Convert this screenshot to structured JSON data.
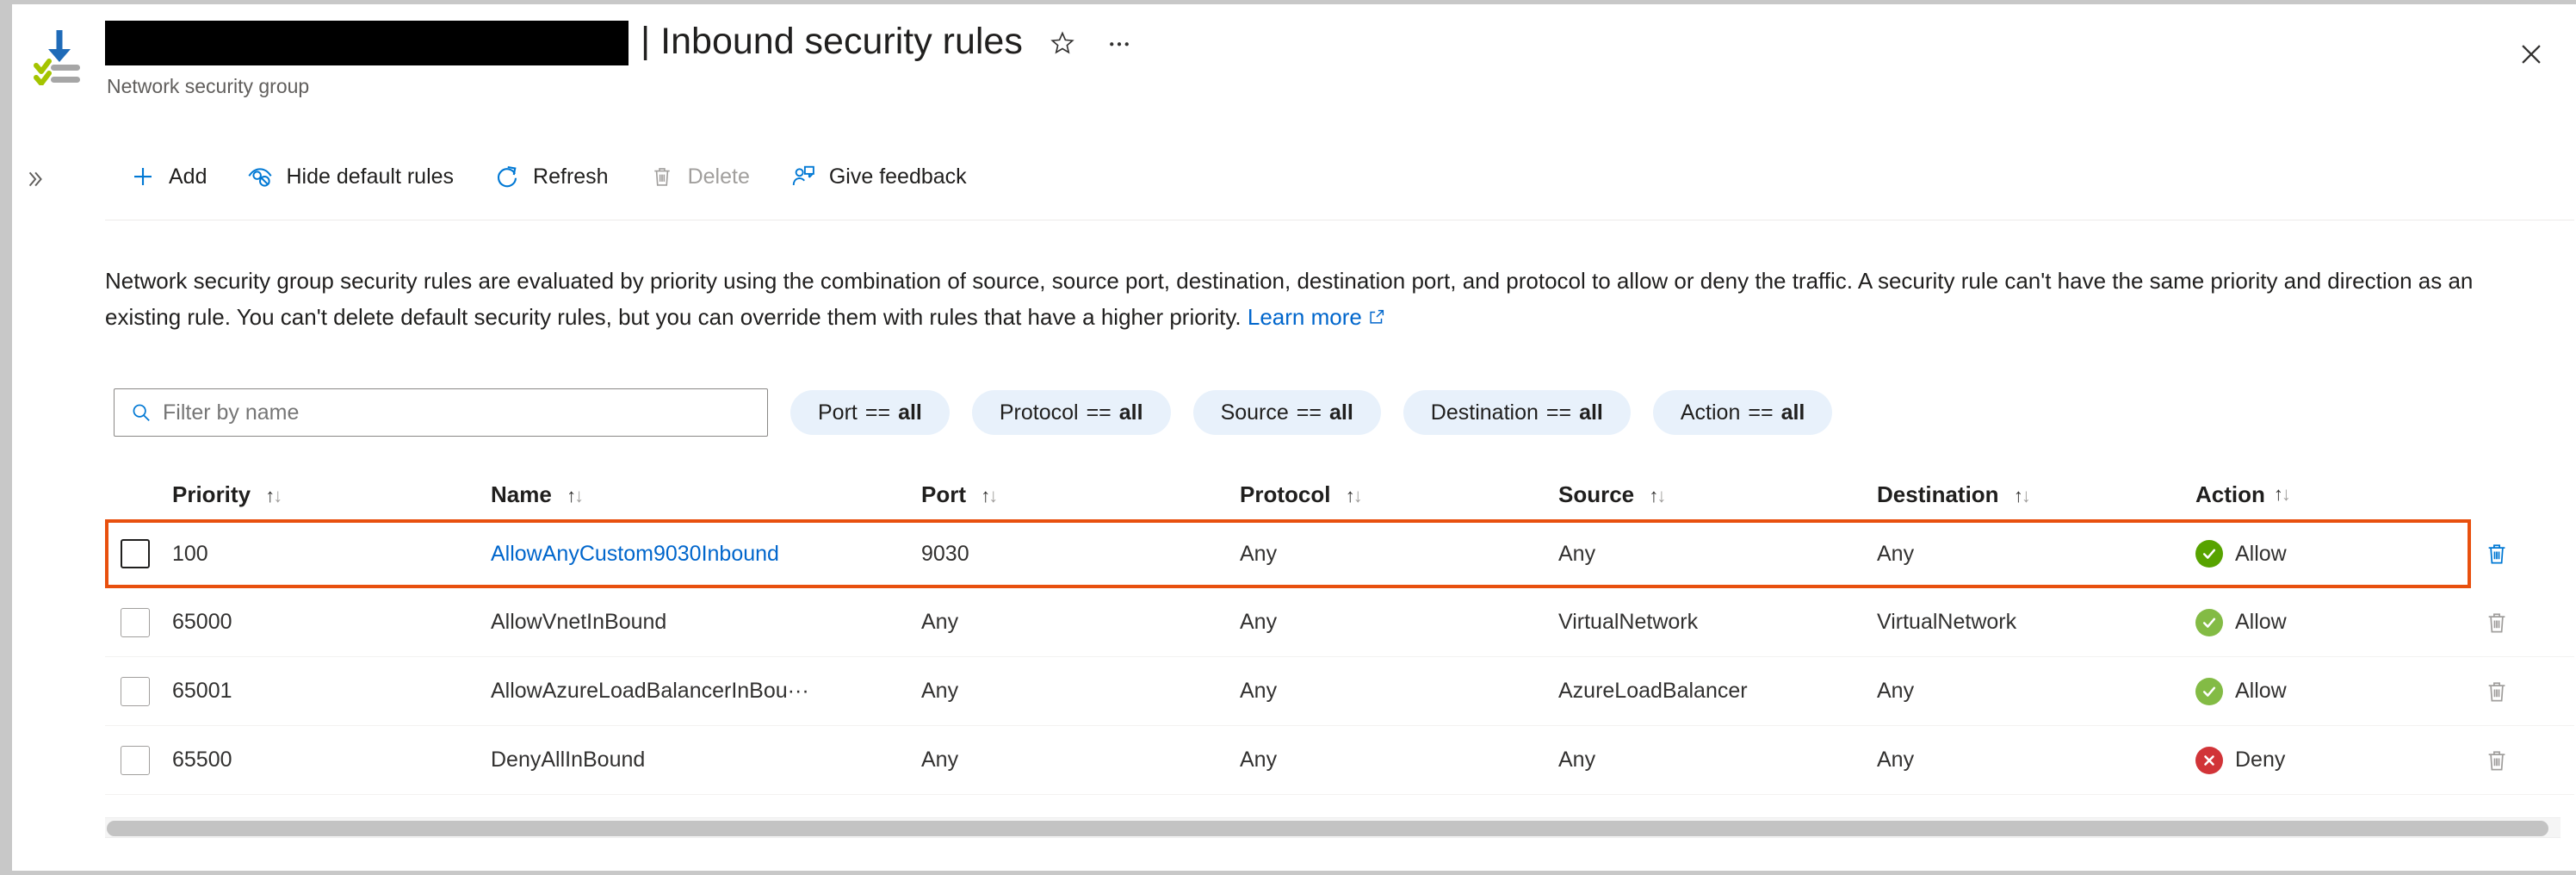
{
  "window": {
    "close_label": "×"
  },
  "header": {
    "resource_name_redacted": "",
    "separator": "|",
    "title": "Inbound security rules",
    "subtitle": "Network security group",
    "favorite_icon": "star-icon",
    "more_icon": "ellipsis-icon",
    "resource_icon": "network-security-group-icon"
  },
  "toolbar": {
    "expand_icon": "double-chevron-right-icon",
    "items": [
      {
        "label": "Add",
        "icon": "plus-icon",
        "disabled": false
      },
      {
        "label": "Hide default rules",
        "icon": "hide-eye-icon",
        "disabled": false
      },
      {
        "label": "Refresh",
        "icon": "refresh-icon",
        "disabled": false
      },
      {
        "label": "Delete",
        "icon": "trash-icon",
        "disabled": true
      },
      {
        "label": "Give feedback",
        "icon": "feedback-person-icon",
        "disabled": false
      }
    ]
  },
  "description": {
    "text": "Network security group security rules are evaluated by priority using the combination of source, source port, destination, destination port, and protocol to allow or deny the traffic. A security rule can't have the same priority and direction as an existing rule. You can't delete default security rules, but you can override them with rules that have a higher priority.",
    "learn_more_label": "Learn more",
    "learn_more_icon": "external-link-icon"
  },
  "filters": {
    "search": {
      "placeholder": "Filter by name",
      "value": "",
      "icon": "search-icon"
    },
    "chips": [
      {
        "key": "Port",
        "op": "==",
        "value": "all"
      },
      {
        "key": "Protocol",
        "op": "==",
        "value": "all"
      },
      {
        "key": "Source",
        "op": "==",
        "value": "all"
      },
      {
        "key": "Destination",
        "op": "==",
        "value": "all"
      },
      {
        "key": "Action",
        "op": "==",
        "value": "all"
      }
    ]
  },
  "table": {
    "columns": [
      {
        "label": "Priority",
        "sortable": true
      },
      {
        "label": "Name",
        "sortable": true
      },
      {
        "label": "Port",
        "sortable": true
      },
      {
        "label": "Protocol",
        "sortable": true
      },
      {
        "label": "Source",
        "sortable": true
      },
      {
        "label": "Destination",
        "sortable": true
      },
      {
        "label": "Action",
        "sortable": true
      }
    ],
    "rows": [
      {
        "priority": "100",
        "name": "AllowAnyCustom9030Inbound",
        "name_is_link": true,
        "port": "9030",
        "protocol": "Any",
        "source": "Any",
        "destination": "Any",
        "action": "Allow",
        "action_type": "allow",
        "delete_enabled": true,
        "highlighted": true,
        "checkbox_focused": true
      },
      {
        "priority": "65000",
        "name": "AllowVnetInBound",
        "name_is_link": false,
        "port": "Any",
        "protocol": "Any",
        "source": "VirtualNetwork",
        "destination": "VirtualNetwork",
        "action": "Allow",
        "action_type": "allow-soft",
        "delete_enabled": false,
        "highlighted": false,
        "checkbox_focused": false
      },
      {
        "priority": "65001",
        "name": "AllowAzureLoadBalancerInBou···",
        "name_is_link": false,
        "port": "Any",
        "protocol": "Any",
        "source": "AzureLoadBalancer",
        "destination": "Any",
        "action": "Allow",
        "action_type": "allow-soft",
        "delete_enabled": false,
        "highlighted": false,
        "checkbox_focused": false
      },
      {
        "priority": "65500",
        "name": "DenyAllInBound",
        "name_is_link": false,
        "port": "Any",
        "protocol": "Any",
        "source": "Any",
        "destination": "Any",
        "action": "Deny",
        "action_type": "deny",
        "delete_enabled": false,
        "highlighted": false,
        "checkbox_focused": false
      }
    ]
  },
  "colors": {
    "accent_blue": "#0078d4",
    "link_blue": "#0066cc",
    "allow_green": "#57a300",
    "deny_red": "#d13438",
    "highlight_orange": "#e8500e",
    "chip_bg": "#e8f1fb"
  }
}
